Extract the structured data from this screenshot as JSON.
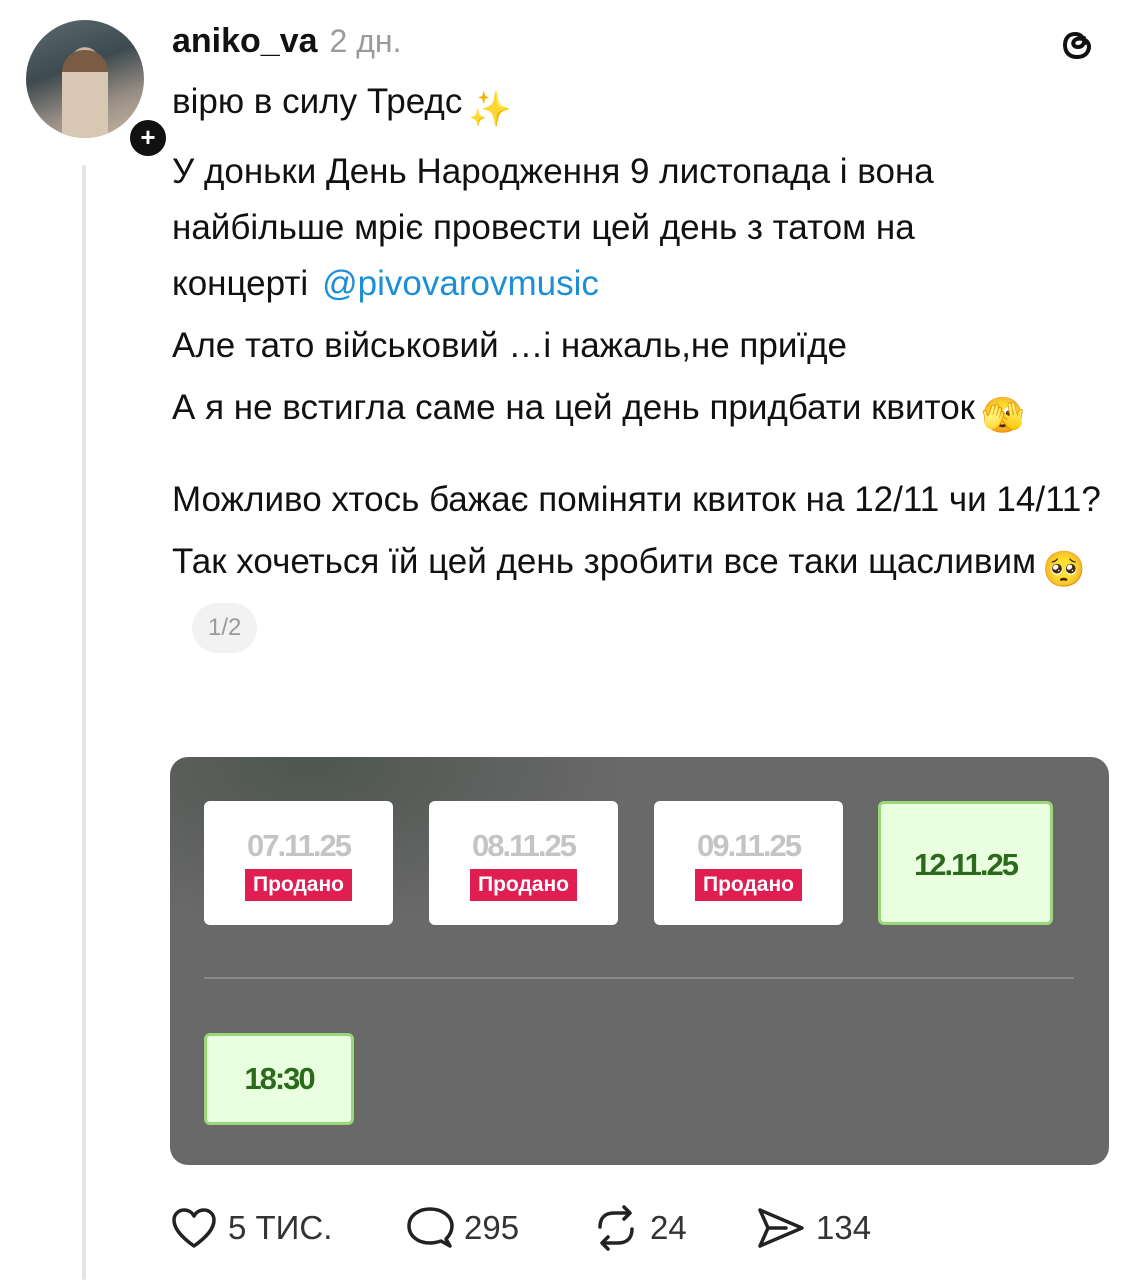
{
  "post": {
    "author": "aniko_va",
    "time": "2 дн.",
    "lines": [
      "вірю в силу Тредс",
      "У  доньки День Народження 9 листопада і вона найбільше мріє провести цей день з татом на концерті",
      "@pivovarovmusic",
      "Але тато військовий …і нажаль,не приїде",
      "А я  не встигла саме на цей день придбати квиток",
      "Можливо хтось бажає поміняти квиток на 12/11 чи 14/11?",
      "Так хочеться їй цей день зробити все таки щасливим"
    ],
    "emojis": {
      "sparkles": "✨",
      "face_in_hands": "🫣",
      "pleading": "🥺"
    },
    "page_counter": "1/2"
  },
  "media": {
    "dates": [
      {
        "date": "07.11.25",
        "status": "Продано"
      },
      {
        "date": "08.11.25",
        "status": "Продано"
      },
      {
        "date": "09.11.25",
        "status": "Продано"
      },
      {
        "date": "12.11.25",
        "status": ""
      }
    ],
    "time": "18:30",
    "colors": {
      "sold_badge": "#e01e52",
      "selected_bg": "#eaffdf",
      "selected_border": "#9ad67a",
      "selected_text": "#2a6a1a"
    }
  },
  "actions": {
    "likes": "5 ТИС.",
    "comments": "295",
    "reposts": "24",
    "shares": "134"
  },
  "icons": [
    "plus-icon",
    "threads-logo-icon",
    "heart-icon",
    "comment-icon",
    "repost-icon",
    "share-icon"
  ]
}
